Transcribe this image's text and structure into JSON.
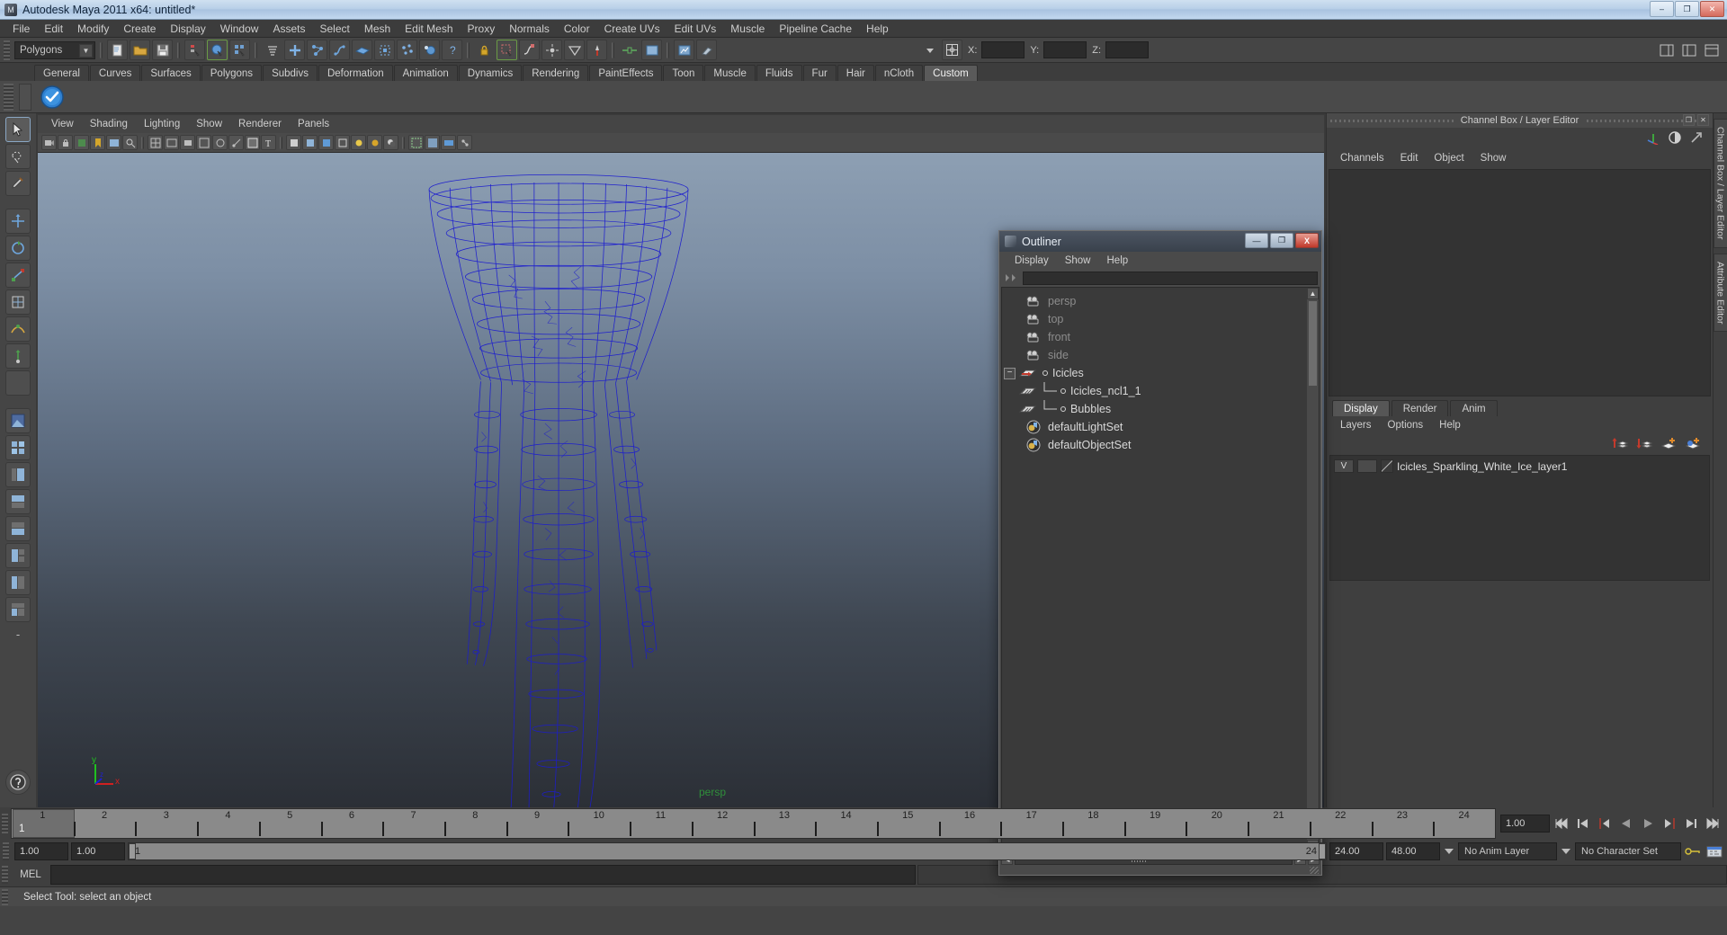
{
  "window": {
    "title": "Autodesk Maya 2011 x64: untitled*",
    "buttons": {
      "minimize": "–",
      "maximize": "❐",
      "close": "✕"
    }
  },
  "menubar": [
    "File",
    "Edit",
    "Modify",
    "Create",
    "Display",
    "Window",
    "Assets",
    "Select",
    "Mesh",
    "Edit Mesh",
    "Proxy",
    "Normals",
    "Color",
    "Create UVs",
    "Edit UVs",
    "Muscle",
    "Pipeline Cache",
    "Help"
  ],
  "statusline": {
    "mode_selector": "Polygons",
    "coordinate_labels": {
      "x": "X:",
      "y": "Y:",
      "z": "Z:"
    },
    "coordinate_values": {
      "x": "",
      "y": "",
      "z": ""
    }
  },
  "shelf": {
    "tabs": [
      "General",
      "Curves",
      "Surfaces",
      "Polygons",
      "Subdivs",
      "Deformation",
      "Animation",
      "Dynamics",
      "Rendering",
      "PaintEffects",
      "Toon",
      "Muscle",
      "Fluids",
      "Fur",
      "Hair",
      "nCloth",
      "Custom"
    ],
    "active_tab": "Custom"
  },
  "viewport": {
    "menus": [
      "View",
      "Shading",
      "Lighting",
      "Show",
      "Renderer",
      "Panels"
    ],
    "camera_label": "persp",
    "axis": {
      "x": "x",
      "y": "y",
      "z": "z"
    }
  },
  "outliner": {
    "title": "Outliner",
    "menus": [
      "Display",
      "Show",
      "Help"
    ],
    "search_value": "",
    "window_buttons": {
      "minimize": "—",
      "maximize": "❐",
      "close": "X"
    },
    "items": [
      {
        "label": "persp",
        "kind": "camera",
        "dim": true,
        "indent": 0,
        "expander": "",
        "branch": ""
      },
      {
        "label": "top",
        "kind": "camera",
        "dim": true,
        "indent": 0,
        "expander": "",
        "branch": ""
      },
      {
        "label": "front",
        "kind": "camera",
        "dim": true,
        "indent": 0,
        "expander": "",
        "branch": ""
      },
      {
        "label": "side",
        "kind": "camera",
        "dim": true,
        "indent": 0,
        "expander": "",
        "branch": ""
      },
      {
        "label": "Icicles",
        "kind": "transform",
        "dim": false,
        "indent": 0,
        "expander": "−",
        "branch": ""
      },
      {
        "label": "Icicles_ncl1_1",
        "kind": "mesh",
        "dim": false,
        "indent": 1,
        "expander": "",
        "branch": "tee"
      },
      {
        "label": "Bubbles",
        "kind": "mesh",
        "dim": false,
        "indent": 1,
        "expander": "",
        "branch": "ell"
      },
      {
        "label": "defaultLightSet",
        "kind": "set",
        "dim": false,
        "indent": 0,
        "expander": "",
        "branch": ""
      },
      {
        "label": "defaultObjectSet",
        "kind": "set",
        "dim": false,
        "indent": 0,
        "expander": "",
        "branch": ""
      }
    ]
  },
  "channelbox": {
    "panel_title": "Channel Box / Layer Editor",
    "menus": [
      "Channels",
      "Edit",
      "Object",
      "Show"
    ],
    "side_tabs": [
      "Channel Box / Layer Editor",
      "Attribute Editor"
    ],
    "panel_buttons": {
      "float": "❐",
      "close": "✕"
    }
  },
  "layereditor": {
    "tabs": [
      "Display",
      "Render",
      "Anim"
    ],
    "active_tab": "Display",
    "menus": [
      "Layers",
      "Options",
      "Help"
    ],
    "layers": [
      {
        "visibility": "V",
        "playback": "",
        "name": "Icicles_Sparkling_White_Ice_layer1"
      }
    ]
  },
  "timeline": {
    "current_frame_label": "1",
    "tick_labels": [
      "1",
      "2",
      "3",
      "4",
      "5",
      "6",
      "7",
      "8",
      "9",
      "10",
      "11",
      "12",
      "13",
      "14",
      "15",
      "16",
      "17",
      "18",
      "19",
      "20",
      "21",
      "22",
      "23",
      "24"
    ],
    "current_time_field": "1.00",
    "playback_buttons": [
      "go-to-start",
      "step-back-key",
      "step-back-frame",
      "play-backwards",
      "play-forwards",
      "step-forward-frame",
      "step-forward-key",
      "go-to-end"
    ]
  },
  "rangeslider": {
    "anim_start": "1.00",
    "range_start": "1.00",
    "bar_start": "1",
    "bar_end": "24",
    "range_end": "24.00",
    "anim_end": "48.00",
    "anim_layer": "No Anim Layer",
    "character_set": "No Character Set"
  },
  "command": {
    "label": "MEL",
    "input_value": ""
  },
  "helpline": {
    "text": "Select Tool: select an object"
  },
  "colors": {
    "accent_blue": "#3a6ea5",
    "wireframe": "#1b1bd0",
    "viewport_label_green": "#2f8f3a",
    "axis_x": "#d02020",
    "axis_y": "#20c020",
    "axis_z": "#2020d0",
    "close_red": "#c0392b"
  }
}
